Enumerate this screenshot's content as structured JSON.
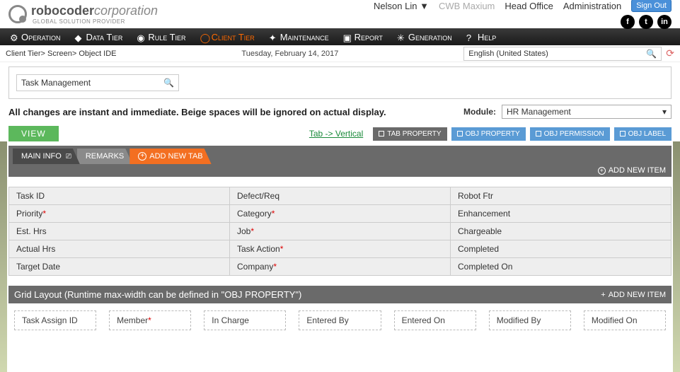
{
  "header": {
    "brand_main": "robocoder",
    "brand_sub": "corporation",
    "brand_tag": "GLOBAL SOLUTION PROVIDER",
    "user": "Nelson Lin",
    "links": [
      "CWB Maxium",
      "Head Office",
      "Administration"
    ],
    "signout": "Sign Out"
  },
  "nav": {
    "items": [
      "Operation",
      "Data Tier",
      "Rule Tier",
      "Client Tier",
      "Maintenance",
      "Report",
      "Generation",
      "Help"
    ],
    "active_index": 3
  },
  "crumb": {
    "path": "Client Tier> Screen> Object IDE",
    "date": "Tuesday, February 14, 2017",
    "language": "English (United States)"
  },
  "search": {
    "value": "Task Management"
  },
  "info_text": "All changes are instant and immediate. Beige spaces will be ignored on actual display.",
  "module": {
    "label": "Module:",
    "value": "HR Management"
  },
  "buttons": {
    "view": "VIEW",
    "tab_link": "Tab -> Vertical",
    "props": [
      "TAB PROPERTY",
      "OBJ PROPERTY",
      "OBJ PERMISSION",
      "OBJ LABEL"
    ]
  },
  "tabs": {
    "items": [
      "MAIN INFO",
      "REMARKS"
    ],
    "active_index": 0,
    "add_label": "ADD NEW TAB"
  },
  "add_item_label": "ADD NEW ITEM",
  "fields": [
    [
      {
        "t": "Task ID"
      },
      {
        "t": "Defect/Req"
      },
      {
        "t": "Robot Ftr"
      }
    ],
    [
      {
        "t": "Priority",
        "r": true
      },
      {
        "t": "Category",
        "r": true
      },
      {
        "t": "Enhancement"
      }
    ],
    [
      {
        "t": "Est. Hrs"
      },
      {
        "t": "Job",
        "r": true
      },
      {
        "t": "Chargeable"
      }
    ],
    [
      {
        "t": "Actual Hrs"
      },
      {
        "t": "Task Action",
        "r": true
      },
      {
        "t": "Completed"
      }
    ],
    [
      {
        "t": "Target Date"
      },
      {
        "t": "Company",
        "r": true
      },
      {
        "t": "Completed On"
      }
    ]
  ],
  "grid": {
    "title": "Grid Layout (Runtime max-width can be defined in \"OBJ PROPERTY\")",
    "cols": [
      {
        "t": "Task Assign ID"
      },
      {
        "t": "Member",
        "r": true
      },
      {
        "t": "In Charge"
      },
      {
        "t": "Entered By"
      },
      {
        "t": "Entered On"
      },
      {
        "t": "Modified By"
      },
      {
        "t": "Modified On"
      }
    ]
  }
}
